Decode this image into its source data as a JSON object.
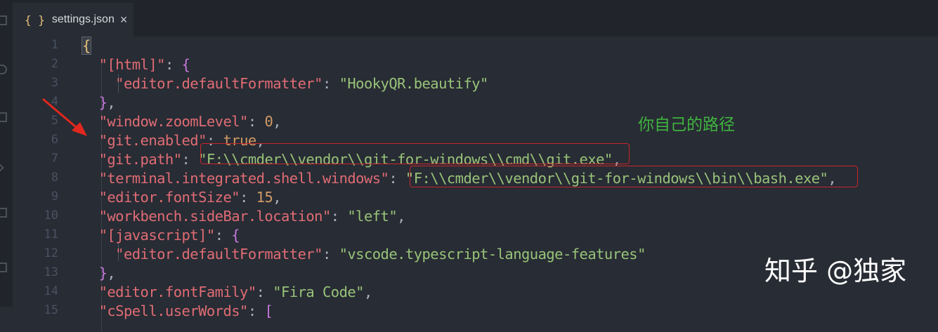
{
  "tab": {
    "icon": "json-braces-icon",
    "title": "settings.json",
    "close": "×"
  },
  "lines": [
    {
      "n": "1"
    },
    {
      "n": "2"
    },
    {
      "n": "3"
    },
    {
      "n": "4"
    },
    {
      "n": "5"
    },
    {
      "n": "6"
    },
    {
      "n": "7"
    },
    {
      "n": "8"
    },
    {
      "n": "9"
    },
    {
      "n": "10"
    },
    {
      "n": "11"
    },
    {
      "n": "12"
    },
    {
      "n": "13"
    },
    {
      "n": "14"
    },
    {
      "n": "15"
    }
  ],
  "code": {
    "brace_open": "{",
    "html_key": "\"[html]\"",
    "formatter_key": "\"editor.defaultFormatter\"",
    "html_formatter_val": "\"HookyQR.beautify\"",
    "zoom_key": "\"window.zoomLevel\"",
    "zoom_val": "0",
    "git_enabled_key": "\"git.enabled\"",
    "git_enabled_val": "true",
    "git_path_key": "\"git.path\"",
    "git_path_val": "\"F:\\\\cmder\\\\vendor\\\\git-for-windows\\\\cmd\\\\git.exe\"",
    "shell_key": "\"terminal.integrated.shell.windows\"",
    "shell_val": "\"F:\\\\cmder\\\\vendor\\\\git-for-windows\\\\bin\\\\bash.exe\"",
    "font_size_key": "\"editor.fontSize\"",
    "font_size_val": "15",
    "sidebar_key": "\"workbench.sideBar.location\"",
    "sidebar_val": "\"left\"",
    "js_key": "\"[javascript]\"",
    "js_formatter_val": "\"vscode.typescript-language-features\"",
    "font_family_key": "\"editor.fontFamily\"",
    "font_family_val": "\"Fira Code\"",
    "cspell_key": "\"cSpell.userWords\""
  },
  "annotation": "你自己的路径",
  "watermark": "知乎 @独家",
  "colors": {
    "key": "#e06c75",
    "string": "#98c379",
    "number": "#d19a66",
    "bracket": "#c678dd",
    "highlight": "#c8262c",
    "annotation": "#3fb43f"
  }
}
